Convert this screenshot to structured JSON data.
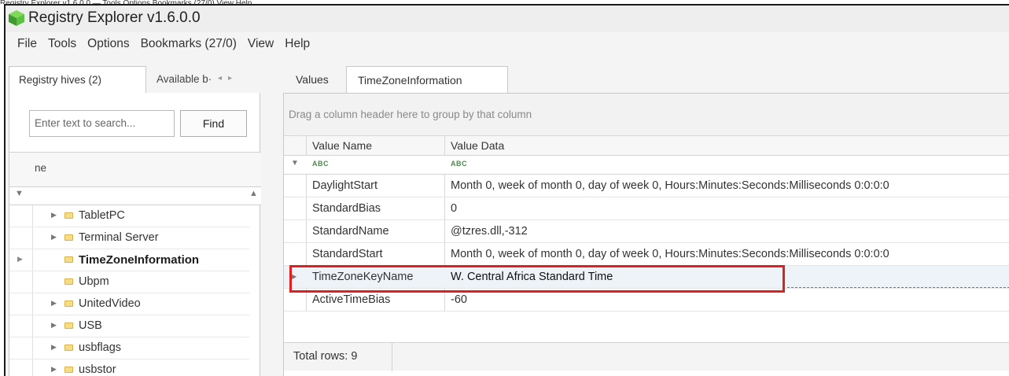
{
  "caption": "Registry Explorer v1.6.0.0 — Tools Options Bookmarks (27/0) View Help",
  "window": {
    "title": "Registry Explorer v1.6.0.0"
  },
  "menu": [
    "File",
    "Tools",
    "Options",
    "Bookmarks (27/0)",
    "View",
    "Help"
  ],
  "left": {
    "tabs": {
      "registry_hives": "Registry hives (2)",
      "available": "Available b·"
    },
    "search": {
      "placeholder": "Enter text to search...",
      "button": "Find"
    },
    "tree_header": "ne",
    "tree": [
      {
        "label": "TabletPC",
        "expandable": true,
        "selected": false
      },
      {
        "label": "Terminal Server",
        "expandable": true,
        "selected": false
      },
      {
        "label": "TimeZoneInformation",
        "expandable": false,
        "selected": true
      },
      {
        "label": "Ubpm",
        "expandable": false,
        "selected": false
      },
      {
        "label": "UnitedVideo",
        "expandable": true,
        "selected": false
      },
      {
        "label": "USB",
        "expandable": true,
        "selected": false
      },
      {
        "label": "usbflags",
        "expandable": true,
        "selected": false
      },
      {
        "label": "usbstor",
        "expandable": true,
        "selected": false
      }
    ]
  },
  "right": {
    "tabs": {
      "values": "Values",
      "active": "TimeZoneInformation"
    },
    "group_hint": "Drag a column header here to group by that column",
    "columns": {
      "name": "Value Name",
      "data": "Value Data"
    },
    "filter_glyph": "ABC",
    "rows": [
      {
        "name": "DaylightStart",
        "data": "Month 0, week of month 0, day of week 0, Hours:Minutes:Seconds:Milliseconds 0:0:0:0"
      },
      {
        "name": "StandardBias",
        "data": "0"
      },
      {
        "name": "StandardName",
        "data": "@tzres.dll,-312"
      },
      {
        "name": "StandardStart",
        "data": "Month 0, week of month 0, day of week 0, Hours:Minutes:Seconds:Milliseconds 0:0:0:0"
      },
      {
        "name": "TimeZoneKeyName",
        "data": "W. Central Africa Standard Time"
      },
      {
        "name": "ActiveTimeBias",
        "data": "-60"
      }
    ],
    "focused_row": "TimeZoneKeyName",
    "footer": "Total rows: 9"
  },
  "colors": {
    "highlight": "#e02020",
    "folder": "#f3dc8a"
  }
}
